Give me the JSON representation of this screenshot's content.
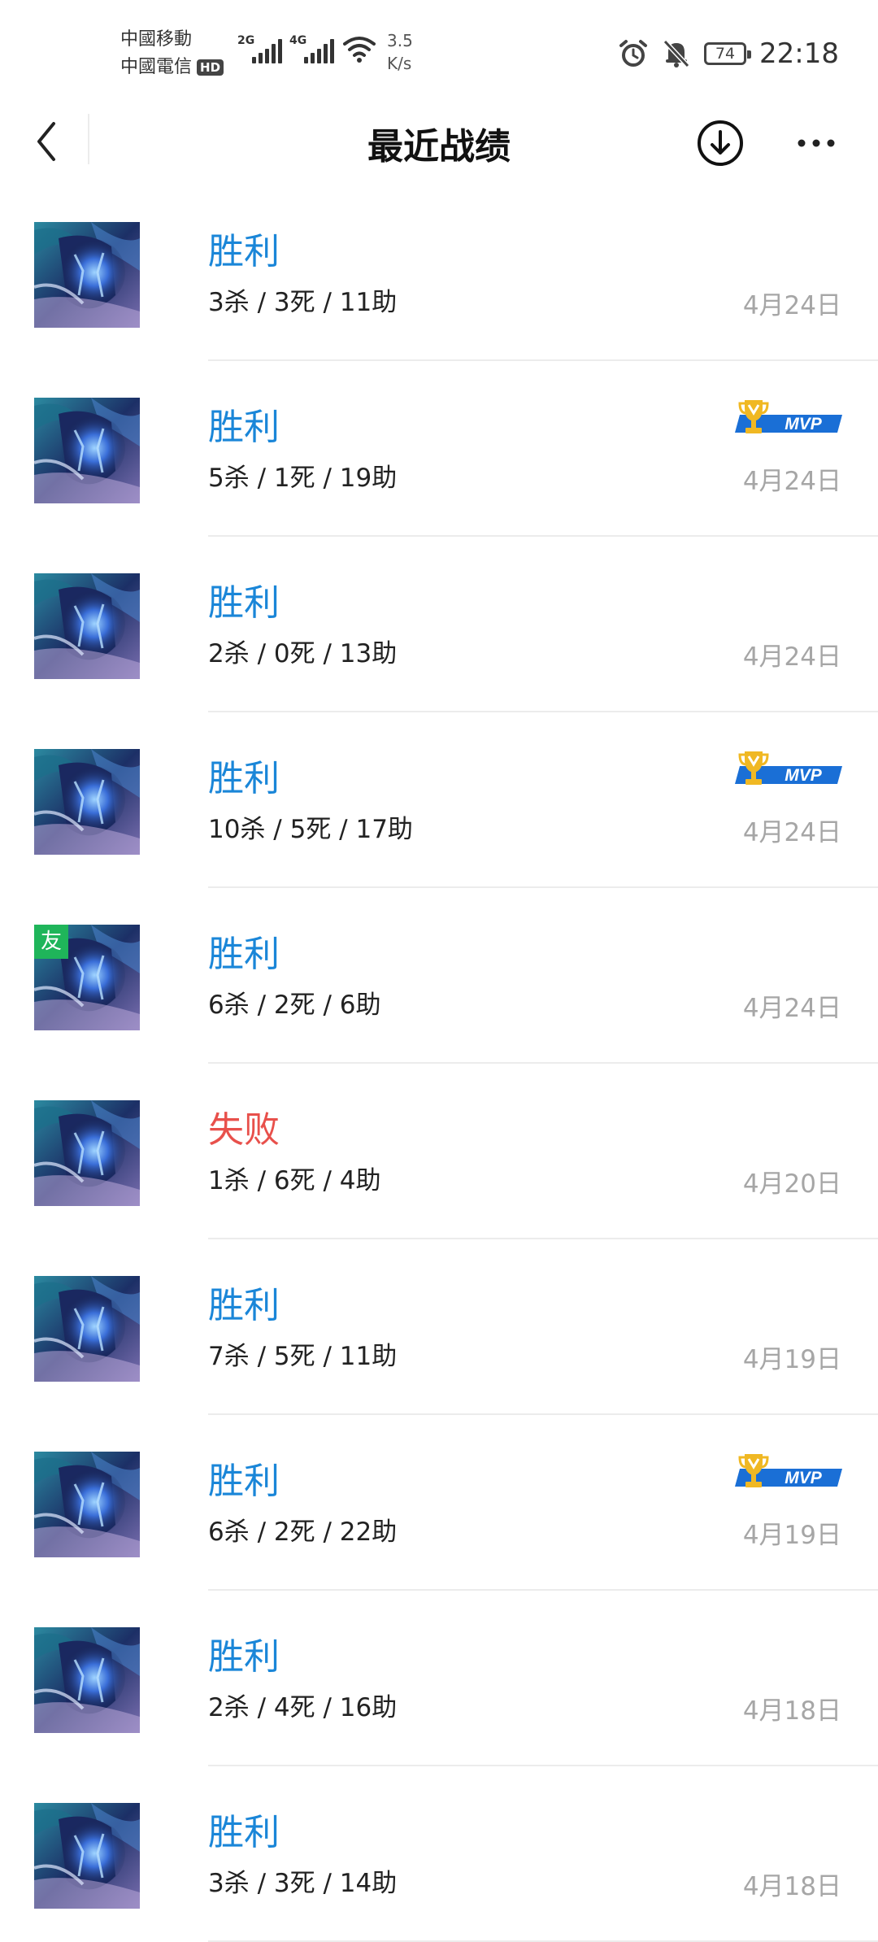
{
  "status_bar": {
    "carrier_1": "中國移動",
    "carrier_2": "中國電信",
    "hd_badge": "HD",
    "signal_1_type": "2G",
    "signal_2_type": "4G",
    "speed_value": "3.5",
    "speed_unit": "K/s",
    "battery_level": "74",
    "time": "22:18"
  },
  "header": {
    "title": "最近战绩"
  },
  "matches": [
    {
      "result": "胜利",
      "outcome": "win",
      "kda": "3杀 / 3死 / 11助",
      "date": "4月24日",
      "mvp": false,
      "friend": false
    },
    {
      "result": "胜利",
      "outcome": "win",
      "kda": "5杀 / 1死 / 19助",
      "date": "4月24日",
      "mvp": true,
      "friend": false
    },
    {
      "result": "胜利",
      "outcome": "win",
      "kda": "2杀 / 0死 / 13助",
      "date": "4月24日",
      "mvp": false,
      "friend": false
    },
    {
      "result": "胜利",
      "outcome": "win",
      "kda": "10杀 / 5死 / 17助",
      "date": "4月24日",
      "mvp": true,
      "friend": false
    },
    {
      "result": "胜利",
      "outcome": "win",
      "kda": "6杀 / 2死 / 6助",
      "date": "4月24日",
      "mvp": false,
      "friend": true
    },
    {
      "result": "失败",
      "outcome": "lose",
      "kda": "1杀 / 6死 / 4助",
      "date": "4月20日",
      "mvp": false,
      "friend": false
    },
    {
      "result": "胜利",
      "outcome": "win",
      "kda": "7杀 / 5死 / 11助",
      "date": "4月19日",
      "mvp": false,
      "friend": false
    },
    {
      "result": "胜利",
      "outcome": "win",
      "kda": "6杀 / 2死 / 22助",
      "date": "4月19日",
      "mvp": true,
      "friend": false
    },
    {
      "result": "胜利",
      "outcome": "win",
      "kda": "2杀 / 4死 / 16助",
      "date": "4月18日",
      "mvp": false,
      "friend": false
    },
    {
      "result": "胜利",
      "outcome": "win",
      "kda": "3杀 / 3死 / 14助",
      "date": "4月18日",
      "mvp": false,
      "friend": false
    }
  ],
  "labels": {
    "mvp": "MVP",
    "friend": "友"
  },
  "colors": {
    "win": "#1a86d8",
    "lose": "#e8504b",
    "date": "#a6a6a6",
    "friend_badge": "#1fb55a",
    "mvp_blue": "#1a6fd6",
    "mvp_gold": "#f0b823"
  },
  "icons": {
    "back": "chevron-left-icon",
    "download": "download-circle-icon",
    "more": "more-dots-icon",
    "mvp": "trophy-icon"
  }
}
